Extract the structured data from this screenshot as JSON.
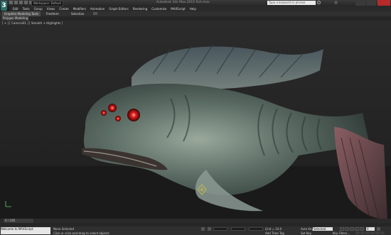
{
  "titlebar": {
    "app_logo": "3",
    "workspace": "Workspace: Default",
    "window_title": "Autodesk 3ds Max 2015   fish.max",
    "search_placeholder": "Type a keyword or phrase"
  },
  "menu": [
    "Edit",
    "Tools",
    "Group",
    "Views",
    "Create",
    "Modifiers",
    "Animation",
    "Graph Editors",
    "Rendering",
    "Customize",
    "MAXScript",
    "Help"
  ],
  "ribbon": {
    "tabs": [
      "Graphite Modeling Tools",
      "Freeform",
      "Selection"
    ],
    "panel": "Polygon Modeling"
  },
  "viewport": {
    "label": "[ + ] [ Camera01 ] [ Smooth + Highlights ]"
  },
  "timeslider": {
    "frame": "0 / 100"
  },
  "status": {
    "listener": "Welcome to MAXScript.",
    "selection": "None Selected",
    "prompt": "Click or click-and-drag to select objects",
    "grid": "Grid = 10.0",
    "add_time_tag": "Add Time Tag",
    "auto_key": "Auto Key",
    "auto_key_value": "Selected",
    "set_key": "Set Key",
    "key_filters": "Key Filters...",
    "frame_field": "0"
  }
}
